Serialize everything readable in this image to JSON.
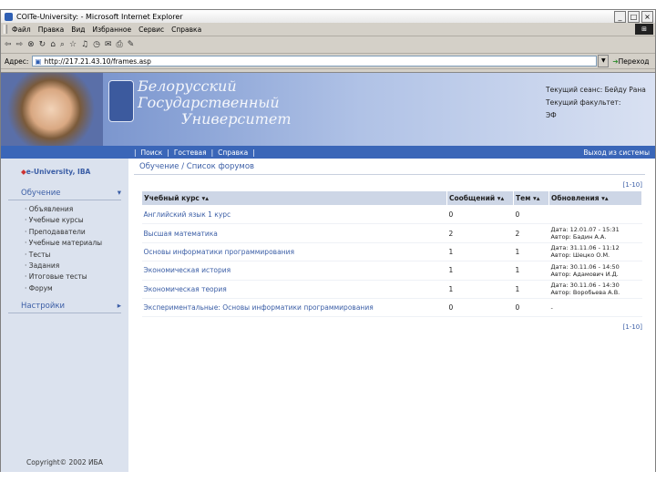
{
  "window": {
    "title": "COITe-University: - Microsoft Internet Explorer",
    "buttons": [
      "_",
      "□",
      "×"
    ]
  },
  "menubar": {
    "items": [
      "Файл",
      "Правка",
      "Вид",
      "Избранное",
      "Сервис",
      "Справка"
    ]
  },
  "addressbar": {
    "label": "Адрес:",
    "url": "http://217.21.43.10/frames.asp",
    "go_label": "Переход"
  },
  "banner": {
    "university_lines": [
      "Белорусский",
      "Государственный",
      "Университет"
    ],
    "session_line1": "Текущий сеанс: Бейду Рана",
    "session_line2": "Текущий факультет:",
    "session_line3": "ЭФ"
  },
  "navbar": {
    "links": [
      "Поиск",
      "Гостевая",
      "Справка"
    ],
    "separators": [
      "|",
      "|",
      "|",
      "|"
    ],
    "exit_label": "Выход из системы"
  },
  "sidebar": {
    "brand": "e-University, IBA",
    "section1": "Обучение",
    "section1_items": [
      "Объявления",
      "Учебные курсы",
      "Преподаватели",
      "Учебные материалы",
      "Тесты",
      "Задания",
      "Итоговые тесты",
      "Форум"
    ],
    "section2": "Настройки",
    "copyright": "Copyright© 2002 ИБА"
  },
  "main": {
    "breadcrumb": "Обучение / Список форумов",
    "pager_top": "[1-10]",
    "pager_bottom": "[1-10]",
    "columns": [
      "Учебный курс",
      "Сообщений",
      "Тем",
      "Обновления"
    ],
    "rows": [
      {
        "course": "Английский язык 1 курс",
        "messages": "0",
        "topics": "0",
        "update1": "",
        "update2": ""
      },
      {
        "course": "Высшая математика",
        "messages": "2",
        "topics": "2",
        "update1": "Дата: 12.01.07 - 15:31",
        "update2": "Автор: Бадин А.А."
      },
      {
        "course": "Основы информатики программирования",
        "messages": "1",
        "topics": "1",
        "update1": "Дата: 31.11.06 - 11:12",
        "update2": "Автор: Шецко О.М."
      },
      {
        "course": "Экономическая история",
        "messages": "1",
        "topics": "1",
        "update1": "Дата: 30.11.06 - 14:50",
        "update2": "Автор: Адамович И.Д."
      },
      {
        "course": "Экономическая теория",
        "messages": "1",
        "topics": "1",
        "update1": "Дата: 30.11.06 - 14:30",
        "update2": "Автор: Воробьева А.В."
      },
      {
        "course": "Экспериментальные: Основы информатики программирования",
        "messages": "0",
        "topics": "0",
        "update1": "-",
        "update2": ""
      }
    ]
  }
}
